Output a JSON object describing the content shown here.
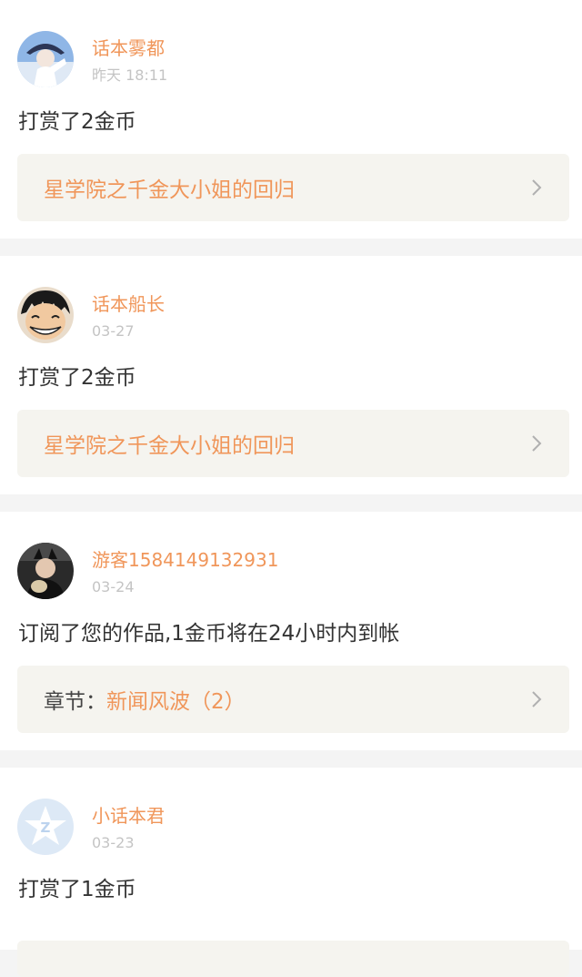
{
  "feed": {
    "items": [
      {
        "user": "话本雾都",
        "time": "昨天 18:11",
        "message": "打赏了2金币",
        "link_prefix": "",
        "link_title": "星学院之千金大小姐的回归",
        "avatar": "anime-character-avatar"
      },
      {
        "user": "话本船长",
        "time": "03-27",
        "message": "打赏了2金币",
        "link_prefix": "",
        "link_title": "星学院之千金大小姐的回归",
        "avatar": "luffy-avatar"
      },
      {
        "user": "游客1584149132931",
        "time": "03-24",
        "message": "订阅了您的作品,1金币将在24小时内到帐",
        "link_prefix": "章节：",
        "link_title": "新闻风波（2）",
        "avatar": "child-photo-avatar"
      },
      {
        "user": "小话本君",
        "time": "03-23",
        "message": "打赏了1金币",
        "link_prefix": "",
        "link_title": "",
        "avatar": "default-z-logo-avatar"
      }
    ]
  },
  "colors": {
    "accent": "#f0965a",
    "time": "#c4c4c4",
    "text": "#333333",
    "link_bg": "#f5f4ef",
    "page_bg": "#f4f4f4"
  },
  "icons": {
    "chevron": "chevron-right-icon"
  }
}
